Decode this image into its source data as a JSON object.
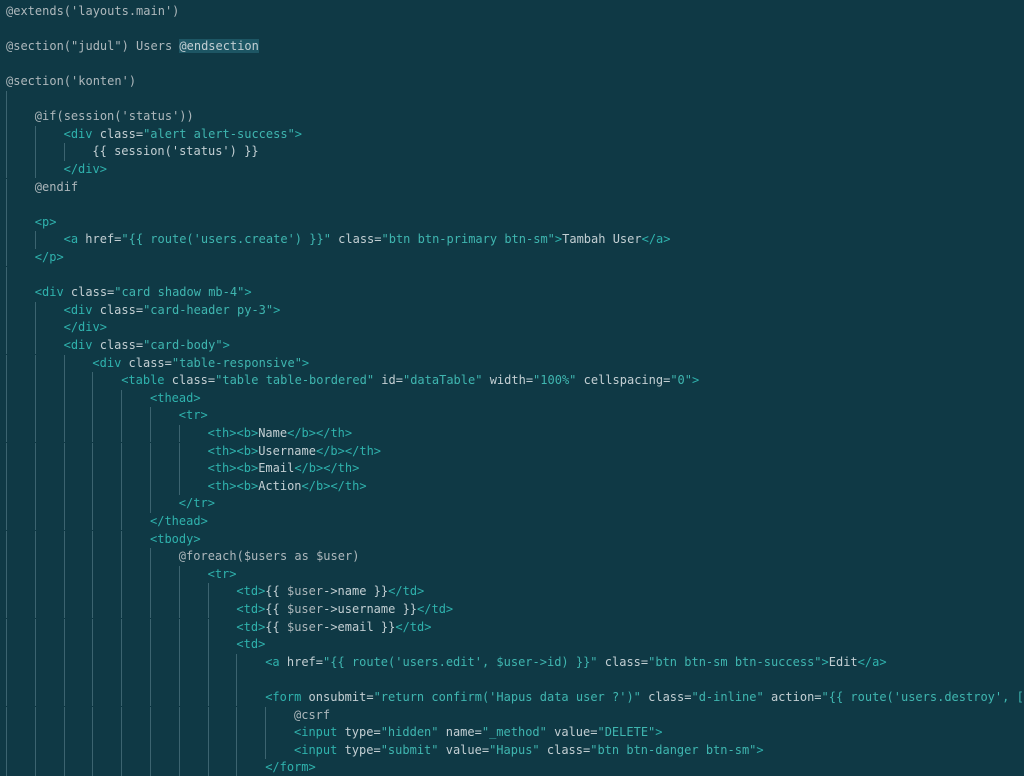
{
  "editor": {
    "lines": [
      [
        [
          "@extends('layouts.main')",
          "kw"
        ]
      ],
      [],
      [
        [
          "@section(\"judul\") Users ",
          "kw"
        ],
        [
          "@endsection",
          "hl"
        ]
      ],
      [],
      [
        [
          "@section('konten')",
          "kw"
        ]
      ],
      [],
      [
        [
          "@if(session('status'))",
          "kw"
        ]
      ],
      [
        [
          "<div ",
          "tag"
        ],
        [
          "class=",
          "attr"
        ],
        [
          "\"alert alert-success\"",
          "str"
        ],
        [
          ">",
          "tag"
        ]
      ],
      [
        [
          "{{ session('status') }}",
          "plain"
        ]
      ],
      [
        [
          "</div>",
          "tag"
        ]
      ],
      [
        [
          "@endif",
          "kw"
        ]
      ],
      [],
      [
        [
          "<p>",
          "tag"
        ]
      ],
      [
        [
          "<a ",
          "tag"
        ],
        [
          "href=",
          "attr"
        ],
        [
          "\"{{ route('users.create') }}\"",
          "str"
        ],
        [
          " class=",
          "attr"
        ],
        [
          "\"btn btn-primary btn-sm\"",
          "str"
        ],
        [
          ">",
          "tag"
        ],
        [
          "Tambah User",
          "plain"
        ],
        [
          "</a>",
          "tag"
        ]
      ],
      [
        [
          "</p>",
          "tag"
        ]
      ],
      [],
      [
        [
          "<div ",
          "tag"
        ],
        [
          "class=",
          "attr"
        ],
        [
          "\"card shadow mb-4\"",
          "str"
        ],
        [
          ">",
          "tag"
        ]
      ],
      [
        [
          "<div ",
          "tag"
        ],
        [
          "class=",
          "attr"
        ],
        [
          "\"card-header py-3\"",
          "str"
        ],
        [
          ">",
          "tag"
        ]
      ],
      [
        [
          "</div>",
          "tag"
        ]
      ],
      [
        [
          "<div ",
          "tag"
        ],
        [
          "class=",
          "attr"
        ],
        [
          "\"card-body\"",
          "str"
        ],
        [
          ">",
          "tag"
        ]
      ],
      [
        [
          "<div ",
          "tag"
        ],
        [
          "class=",
          "attr"
        ],
        [
          "\"table-responsive\"",
          "str"
        ],
        [
          ">",
          "tag"
        ]
      ],
      [
        [
          "<table ",
          "tag"
        ],
        [
          "class=",
          "attr"
        ],
        [
          "\"table table-bordered\"",
          "str"
        ],
        [
          " id=",
          "attr"
        ],
        [
          "\"dataTable\"",
          "str"
        ],
        [
          " width=",
          "attr"
        ],
        [
          "\"100%\"",
          "str"
        ],
        [
          " cellspacing=",
          "attr"
        ],
        [
          "\"0\"",
          "str"
        ],
        [
          ">",
          "tag"
        ]
      ],
      [
        [
          "<thead>",
          "tag"
        ]
      ],
      [
        [
          "<tr>",
          "tag"
        ]
      ],
      [
        [
          "<th>",
          "tag"
        ],
        [
          "<b>",
          "tag"
        ],
        [
          "Name",
          "plain"
        ],
        [
          "</b>",
          "tag"
        ],
        [
          "</th>",
          "tag"
        ]
      ],
      [
        [
          "<th>",
          "tag"
        ],
        [
          "<b>",
          "tag"
        ],
        [
          "Username",
          "plain"
        ],
        [
          "</b>",
          "tag"
        ],
        [
          "</th>",
          "tag"
        ]
      ],
      [
        [
          "<th>",
          "tag"
        ],
        [
          "<b>",
          "tag"
        ],
        [
          "Email",
          "plain"
        ],
        [
          "</b>",
          "tag"
        ],
        [
          "</th>",
          "tag"
        ]
      ],
      [
        [
          "<th>",
          "tag"
        ],
        [
          "<b>",
          "tag"
        ],
        [
          "Action",
          "plain"
        ],
        [
          "</b>",
          "tag"
        ],
        [
          "</th>",
          "tag"
        ]
      ],
      [
        [
          "</tr>",
          "tag"
        ]
      ],
      [
        [
          "</thead>",
          "tag"
        ]
      ],
      [
        [
          "<tbody>",
          "tag"
        ]
      ],
      [
        [
          "@foreach($users as $user)",
          "kw"
        ]
      ],
      [
        [
          "<tr>",
          "tag"
        ]
      ],
      [
        [
          "<td>",
          "tag"
        ],
        [
          "{{ ",
          "plain"
        ],
        [
          "$user",
          "var"
        ],
        [
          "->name }}",
          "plain"
        ],
        [
          "</td>",
          "tag"
        ]
      ],
      [
        [
          "<td>",
          "tag"
        ],
        [
          "{{ ",
          "plain"
        ],
        [
          "$user",
          "var"
        ],
        [
          "->username }}",
          "plain"
        ],
        [
          "</td>",
          "tag"
        ]
      ],
      [
        [
          "<td>",
          "tag"
        ],
        [
          "{{ ",
          "plain"
        ],
        [
          "$user",
          "var"
        ],
        [
          "->email }}",
          "plain"
        ],
        [
          "</td>",
          "tag"
        ]
      ],
      [
        [
          "<td>",
          "tag"
        ]
      ],
      [
        [
          "<a ",
          "tag"
        ],
        [
          "href=",
          "attr"
        ],
        [
          "\"{{ route('users.edit', $user->id) }}\"",
          "str"
        ],
        [
          " class=",
          "attr"
        ],
        [
          "\"btn btn-sm btn-success\"",
          "str"
        ],
        [
          ">",
          "tag"
        ],
        [
          "Edit",
          "plain"
        ],
        [
          "</a>",
          "tag"
        ]
      ],
      [],
      [
        [
          "<form ",
          "tag"
        ],
        [
          "onsubmit=",
          "attr"
        ],
        [
          "\"return confirm('Hapus data user ?')\"",
          "str"
        ],
        [
          " class=",
          "attr"
        ],
        [
          "\"d-inline\"",
          "str"
        ],
        [
          " action=",
          "attr"
        ],
        [
          "\"{{ route('users.destroy', [$u",
          "str"
        ]
      ],
      [
        [
          "@csrf",
          "kw"
        ]
      ],
      [
        [
          "<input ",
          "tag"
        ],
        [
          "type=",
          "attr"
        ],
        [
          "\"hidden\"",
          "str"
        ],
        [
          " name=",
          "attr"
        ],
        [
          "\"_method\"",
          "str"
        ],
        [
          " value=",
          "attr"
        ],
        [
          "\"DELETE\"",
          "str"
        ],
        [
          ">",
          "tag"
        ]
      ],
      [
        [
          "<input ",
          "tag"
        ],
        [
          "type=",
          "attr"
        ],
        [
          "\"submit\"",
          "str"
        ],
        [
          " value=",
          "attr"
        ],
        [
          "\"Hapus\"",
          "str"
        ],
        [
          " class=",
          "attr"
        ],
        [
          "\"btn btn-danger btn-sm\"",
          "str"
        ],
        [
          ">",
          "tag"
        ]
      ],
      [
        [
          "</form>",
          "tag"
        ]
      ]
    ]
  }
}
